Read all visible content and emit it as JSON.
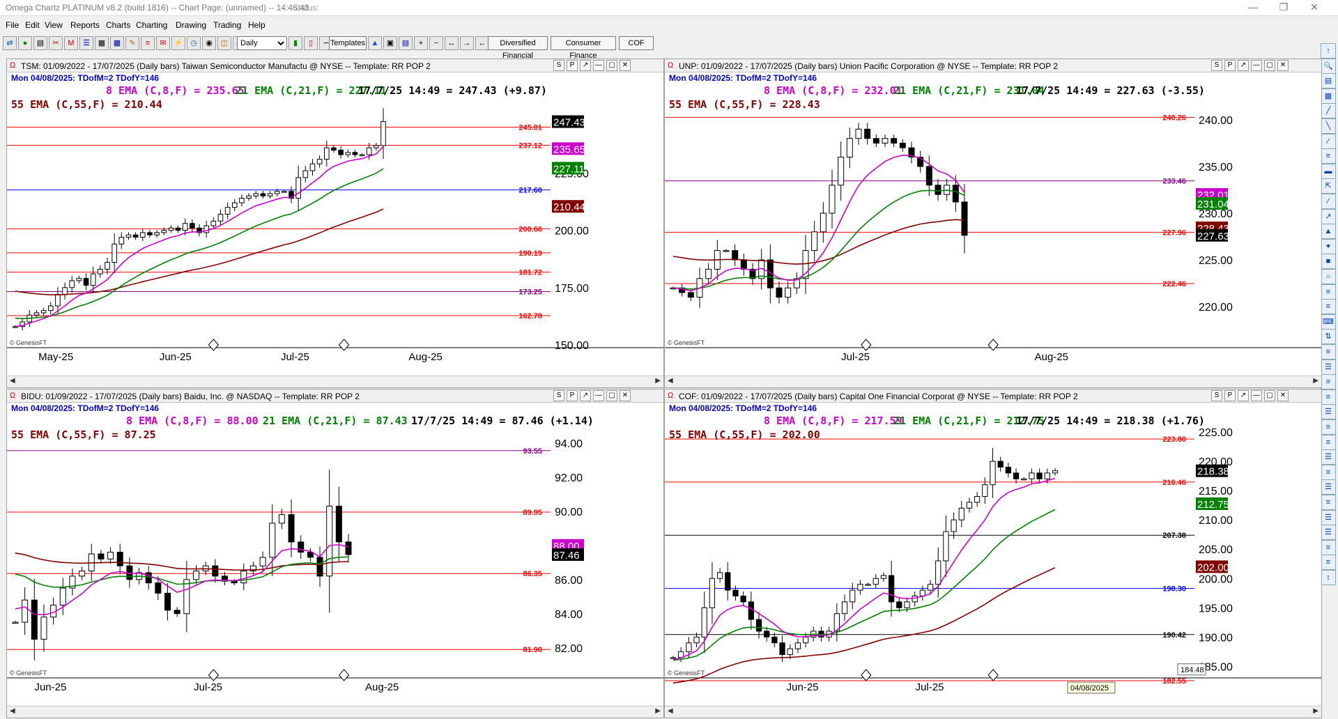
{
  "app": {
    "title": "Omega Chartz PLATINUM v8.2 (build 1816)  --  Chart Page: (unnamed) -- 14:46:43",
    "status_label": "Status:"
  },
  "menu": [
    "File",
    "Edit",
    "View",
    "Reports",
    "Charts",
    "Charting",
    "Drawing",
    "Trading",
    "Help"
  ],
  "toolbar": {
    "period_select": "Daily",
    "templates_label": "Templates",
    "buttons": [
      "Diversified Financial",
      "Consumer Finance",
      "COF"
    ]
  },
  "header_buttons": [
    "S",
    "P",
    "↗"
  ],
  "charts": [
    {
      "title": "TSM: 01/09/2022 - 17/07/2025  (Daily bars)  Taiwan Semiconductor Manufactu @ NYSE  --  Template: RR POP 2",
      "date_info": "Mon  04/08/2025:  TDofM=2  TDofY=146",
      "ema8": "8 EMA (C,8,F) = 235.65",
      "ema21": "21 EMA (C,21,F) = 227.11",
      "last": "17/7/25 14:49 = 247.43 (+9.87)",
      "ema55": "55 EMA (C,55,F) = 210.44",
      "ymin": 150,
      "ymax": 262.5,
      "yticks": [
        "150.00",
        "175.00",
        "200.00",
        "225.00"
      ],
      "xticks": [
        "May-25",
        "Jun-25",
        "Jul-25",
        "Aug-25"
      ],
      "hlines": [
        {
          "v": 245.01,
          "label": "245.01",
          "color": "#ff0000"
        },
        {
          "v": 237.12,
          "label": "237.12",
          "color": "#ff0000"
        },
        {
          "v": 217.6,
          "label": "217.60",
          "color": "#0000ff"
        },
        {
          "v": 200.66,
          "label": "200.66",
          "color": "#ff0000"
        },
        {
          "v": 190.19,
          "label": "190.19",
          "color": "#ff0000"
        },
        {
          "v": 181.72,
          "label": "181.72",
          "color": "#ff0000"
        },
        {
          "v": 173.25,
          "label": "173.25",
          "color": "#800080"
        },
        {
          "v": 162.78,
          "label": "162.78",
          "color": "#ff0000"
        }
      ],
      "price_tags": [
        {
          "v": 247.43,
          "label": "247.43",
          "bg": "#000000"
        },
        {
          "v": 235.65,
          "label": "235.65",
          "bg": "#cc00cc"
        },
        {
          "v": 227.11,
          "label": "227.11",
          "bg": "#008000"
        },
        {
          "v": 210.44,
          "label": "210.44",
          "bg": "#800000"
        }
      ],
      "closes": [
        158,
        160,
        163,
        164,
        165,
        167,
        172,
        175,
        178,
        179,
        176,
        181,
        183,
        186,
        194,
        197,
        198,
        197,
        199,
        198,
        199,
        200,
        201,
        200,
        203,
        201,
        199,
        202,
        204,
        207,
        210,
        212,
        214,
        215,
        216,
        215,
        216,
        217,
        217,
        214,
        223,
        226,
        229,
        231,
        236,
        235,
        233,
        234,
        233,
        233,
        236,
        237,
        247.43
      ],
      "ema_start": {
        "e8": 158,
        "e21": 162,
        "e55": 174
      },
      "genesis": "© GenesisFT"
    },
    {
      "title": "UNP: 01/09/2022 - 17/07/2025  (Daily bars)  Union Pacific Corporation @ NYSE  --  Template: RR POP 2",
      "date_info": "Mon  04/08/2025:  TDofM=2  TDofY=146",
      "ema8": "8 EMA (C,8,F) = 232.01",
      "ema21": "21 EMA (C,21,F) = 231.04",
      "last": "17/7/25 14:49 = 227.63 (-3.55)",
      "ema55": "55 EMA (C,55,F) = 228.43",
      "ymin": 215.9,
      "ymax": 243.5,
      "yticks": [
        "220.00",
        "225.00",
        "230.00",
        "235.00",
        "240.00"
      ],
      "xticks": [
        "Jul-25",
        "Aug-25"
      ],
      "hlines": [
        {
          "v": 240.26,
          "label": "240.26",
          "color": "#ff0000"
        },
        {
          "v": 233.46,
          "label": "233.46",
          "color": "#800080"
        },
        {
          "v": 227.96,
          "label": "227.96",
          "color": "#ff0000"
        },
        {
          "v": 222.46,
          "label": "222.46",
          "color": "#ff0000"
        }
      ],
      "price_tags": [
        {
          "v": 232.01,
          "label": "232.01",
          "bg": "#cc00cc"
        },
        {
          "v": 231.04,
          "label": "231.04",
          "bg": "#008000"
        },
        {
          "v": 228.43,
          "label": "228.43",
          "bg": "#800000"
        },
        {
          "v": 227.63,
          "label": "227.63",
          "bg": "#000000"
        }
      ],
      "closes": [
        222,
        221.5,
        221,
        223,
        224,
        226,
        226,
        225,
        224,
        223,
        225,
        222,
        221,
        222,
        223,
        226,
        228,
        230,
        233,
        236,
        238,
        239,
        238,
        237.5,
        238,
        237.5,
        237,
        236,
        235,
        233,
        232,
        233,
        231.2,
        227.63
      ],
      "ema_start": {
        "e8": 222,
        "e21": 222,
        "e55": 225.5
      },
      "genesis": "© GenesisFT"
    },
    {
      "title": "BIDU: 01/09/2022 - 17/07/2025  (Daily bars)  Baidu, Inc. @ NASDAQ  --  Template: RR POP 2",
      "date_info": "Mon  04/08/2025:  TDofM=2  TDofY=146",
      "ema8": "8 EMA (C,8,F) = 88.00",
      "ema21": "21 EMA (C,21,F) = 87.43",
      "last": "17/7/25 14:49 = 87.46 (+1.14)",
      "ema55": "55 EMA (C,55,F) = 87.25",
      "ymin": 80.4,
      "ymax": 95.5,
      "yticks": [
        "82.00",
        "84.00",
        "86.00",
        "88.00",
        "90.00",
        "92.00",
        "94.00"
      ],
      "xticks": [
        "Jun-25",
        "Jul-25",
        "Aug-25"
      ],
      "hlines": [
        {
          "v": 93.55,
          "label": "93.55",
          "color": "#800080"
        },
        {
          "v": 89.95,
          "label": "89.95",
          "color": "#ff0000"
        },
        {
          "v": 86.35,
          "label": "86.35",
          "color": "#ff0000"
        },
        {
          "v": 81.9,
          "label": "81.90",
          "color": "#ff0000"
        }
      ],
      "price_tags": [
        {
          "v": 88.0,
          "label": "88.00",
          "bg": "#cc00cc"
        },
        {
          "v": 87.46,
          "label": "87.46",
          "bg": "#000000"
        }
      ],
      "closes": [
        83.5,
        84.8,
        82.5,
        83.8,
        84.5,
        85.5,
        86.2,
        86.5,
        87.5,
        87.2,
        87.6,
        86.8,
        86,
        86.4,
        85.8,
        85.2,
        84.2,
        84.0,
        86,
        86.5,
        86.8,
        86.2,
        85.9,
        85.8,
        86.5,
        86.8,
        87.3,
        89.3,
        89.8,
        88.2,
        87.6,
        87.3,
        86.2,
        90.3,
        88.2,
        87.46
      ],
      "ema_start": {
        "e8": 84.5,
        "e21": 86.6,
        "e55": 87.7
      },
      "genesis": "© GenesisFT"
    },
    {
      "title": "COF: 01/09/2022 - 17/07/2025  (Daily bars)  Capital One Financial Corporat @ NYSE  --  Template: RR POP 2",
      "date_info": "Mon  04/08/2025:  TDofM=2  TDofY=146",
      "ema8": "8 EMA (C,8,F) = 217.59",
      "ema21": "21 EMA (C,21,F) = 212.75",
      "last": "17/7/25 14:49 = 218.38 (+1.76)",
      "ema55": "55 EMA (C,55,F) = 202.00",
      "ymin": 183.5,
      "ymax": 227.5,
      "yticks": [
        "185.00",
        "190.00",
        "195.00",
        "200.00",
        "205.00",
        "210.00",
        "215.00",
        "220.00",
        "225.00"
      ],
      "xticks": [
        "Jun-25",
        "Jul-25"
      ],
      "hlines": [
        {
          "v": 223.8,
          "label": "223.80",
          "color": "#ff0000"
        },
        {
          "v": 216.46,
          "label": "216.46",
          "color": "#ff0000"
        },
        {
          "v": 207.38,
          "label": "207.38",
          "color": "#000000"
        },
        {
          "v": 198.3,
          "label": "198.30",
          "color": "#0000ff"
        },
        {
          "v": 190.42,
          "label": "190.42",
          "color": "#000000"
        },
        {
          "v": 182.55,
          "label": "182.55",
          "color": "#ff0000"
        }
      ],
      "price_tags": [
        {
          "v": 218.38,
          "label": "218.38",
          "bg": "#000000"
        },
        {
          "v": 212.75,
          "label": "212.75",
          "bg": "#008000"
        },
        {
          "v": 202.0,
          "label": "202.00",
          "bg": "#800000"
        }
      ],
      "closes": [
        186.5,
        187.5,
        189,
        190,
        195,
        200,
        201,
        198,
        197,
        196,
        193,
        191,
        190,
        189,
        187,
        188,
        189,
        190,
        191,
        190,
        191,
        194,
        196,
        198,
        199,
        199,
        200,
        200.5,
        196,
        195,
        196,
        197,
        198,
        199,
        203,
        208,
        210,
        212,
        213,
        214,
        216,
        220,
        219,
        218,
        217,
        217,
        218,
        217,
        218,
        218.38
      ],
      "ema_start": {
        "e8": 186,
        "e21": 186,
        "e55": 182
      },
      "genesis": "© GenesisFT",
      "crosshair_value": "184.48",
      "crosshair_date": "04/08/2025"
    }
  ]
}
